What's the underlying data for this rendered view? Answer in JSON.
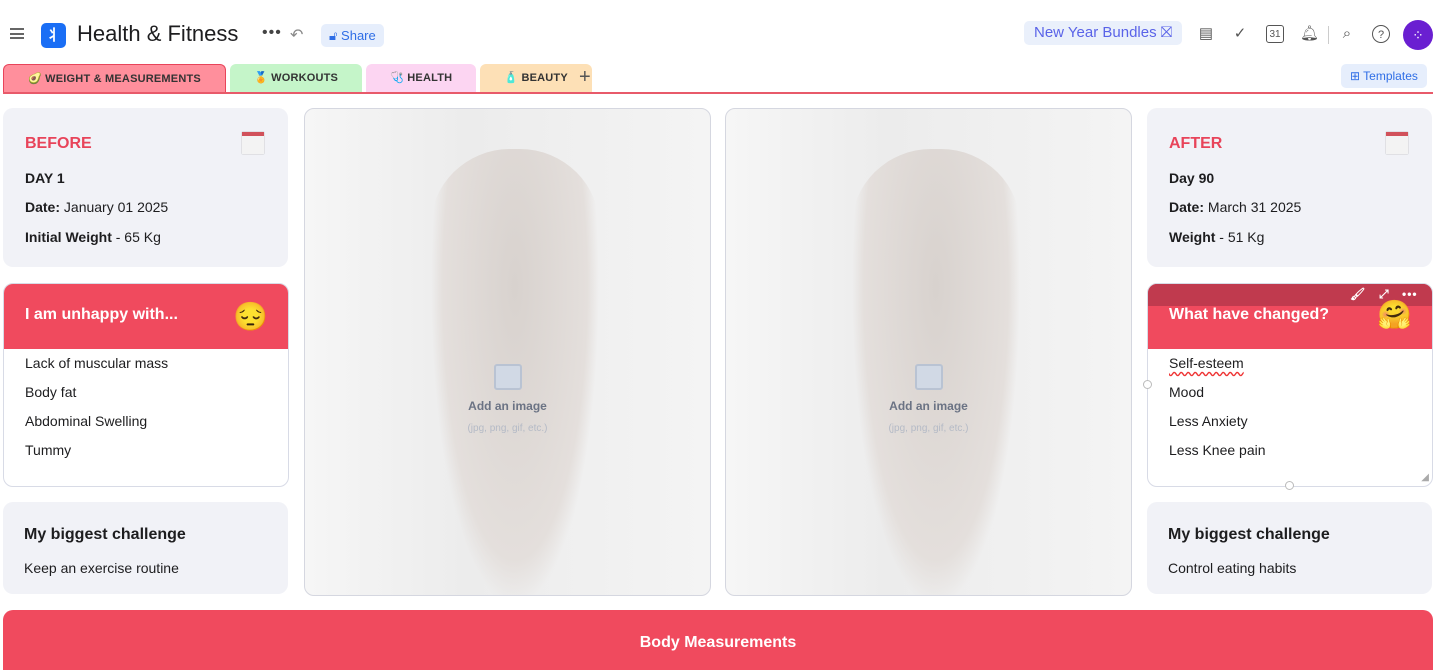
{
  "header": {
    "title": "Health & Fitness",
    "share_label": "Share",
    "bundles_label": "New Year Bundles",
    "avatar_initials": "⁘",
    "accent": "#1a6ef5"
  },
  "tabs": [
    {
      "label": "WEIGHT & MEASUREMENTS",
      "icon": "🥑",
      "color": "#ff8f9c",
      "active": true
    },
    {
      "label": "WORKOUTS",
      "icon": "🏅",
      "color": "#c5f5c9"
    },
    {
      "label": "HEALTH",
      "icon": "🩺",
      "color": "#fcd5f2"
    },
    {
      "label": "BEAUTY",
      "icon": "🧴",
      "color": "#fde0b6"
    }
  ],
  "templates_label": "Templates",
  "before": {
    "heading": "BEFORE",
    "day": "DAY 1",
    "date_label": "Date:",
    "date": "January 01 2025",
    "weight_label": "Initial Weight",
    "weight": "- 65 Kg"
  },
  "after": {
    "heading": "AFTER",
    "day": "Day 90",
    "date_label": "Date:",
    "date": "March 31 2025",
    "weight_label": "Weight",
    "weight": "- 51 Kg"
  },
  "unhappy": {
    "title": "I am unhappy with...",
    "emoji": "😔",
    "items": [
      "Lack of muscular mass",
      "Body fat",
      "Abdominal Swelling",
      "Tummy"
    ]
  },
  "changed": {
    "title": "What have changed?",
    "emoji": "🤗",
    "items": [
      "Self-esteem",
      "Mood",
      "Less Anxiety",
      "Less Knee pain"
    ]
  },
  "image_placeholder": {
    "title": "Add an image",
    "subtitle": "(jpg, png, gif, etc.)"
  },
  "challenge_left": {
    "title": "My biggest challenge",
    "value": "Keep an exercise routine"
  },
  "challenge_right": {
    "title": "My biggest challenge",
    "value": "Control eating habits"
  },
  "body_measurements": "Body Measurements",
  "brand_red": "#f04a5e"
}
